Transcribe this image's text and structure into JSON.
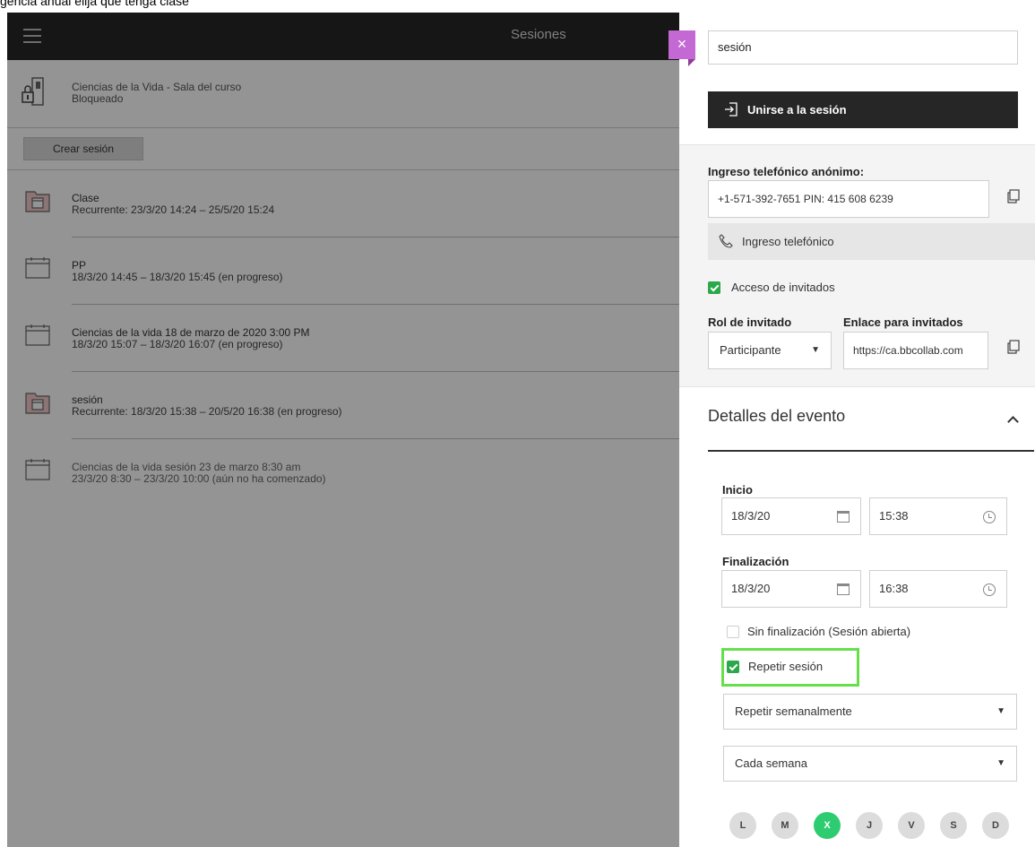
{
  "caption": "gencia anual elija que tenga clase",
  "topbar": {
    "title": "Sesiones"
  },
  "room": {
    "name": "Ciencias de la Vida - Sala del curso",
    "status": "Bloqueado"
  },
  "create_button": "Crear sesión",
  "sessions": [
    {
      "title": "Clase",
      "detail": "Recurrente: 23/3/20 14:24 – 25/5/20 15:24",
      "icon": "recurring-calendar-icon"
    },
    {
      "title": "PP",
      "detail": "18/3/20 14:45 – 18/3/20 15:45 (en progreso)",
      "icon": "calendar-icon"
    },
    {
      "title": "Ciencias de la vida 18 de marzo de 2020 3:00 PM",
      "detail": "18/3/20 15:07 – 18/3/20 16:07 (en progreso)",
      "icon": "calendar-icon"
    },
    {
      "title": "sesión",
      "detail": "Recurrente: 18/3/20 15:38 – 20/5/20 16:38 (en progreso)",
      "icon": "recurring-calendar-icon"
    },
    {
      "title": "Ciencias de la vida sesión 23 de marzo 8:30 am",
      "detail": "23/3/20 8:30 – 23/3/20 10:00 (aún no ha comenzado)",
      "icon": "calendar-icon"
    }
  ],
  "panel": {
    "close_icon": "×",
    "session_name": "sesión",
    "join_label": "Unirse a la sesión",
    "phone_label": "Ingreso telefónico anónimo:",
    "phone_value": "+1-571-392-7651 PIN: 415 608 6239",
    "phone_button": "Ingreso telefónico",
    "guest_access_label": "Acceso de invitados",
    "guest_role_label": "Rol de invitado",
    "guest_role_value": "Participante",
    "guest_link_label": "Enlace para invitados",
    "guest_link_value": "https://ca.bbcollab.com",
    "details_heading": "Detalles del evento",
    "start_label": "Inicio",
    "start_date": "18/3/20",
    "start_time": "15:38",
    "end_label": "Finalización",
    "end_date": "18/3/20",
    "end_time": "16:38",
    "no_end_label": "Sin finalización (Sesión abierta)",
    "repeat_label": "Repetir sesión",
    "repeat_select": "Repetir semanalmente",
    "every_select": "Cada semana",
    "days": [
      "L",
      "M",
      "X",
      "J",
      "V",
      "S",
      "D"
    ],
    "selected_day": "X"
  },
  "colors": {
    "accent_close": "#c468d3",
    "check_green": "#2aa84a",
    "highlight": "#66e04a",
    "day_selected": "#2ecc71",
    "dark_bar": "#262626"
  }
}
